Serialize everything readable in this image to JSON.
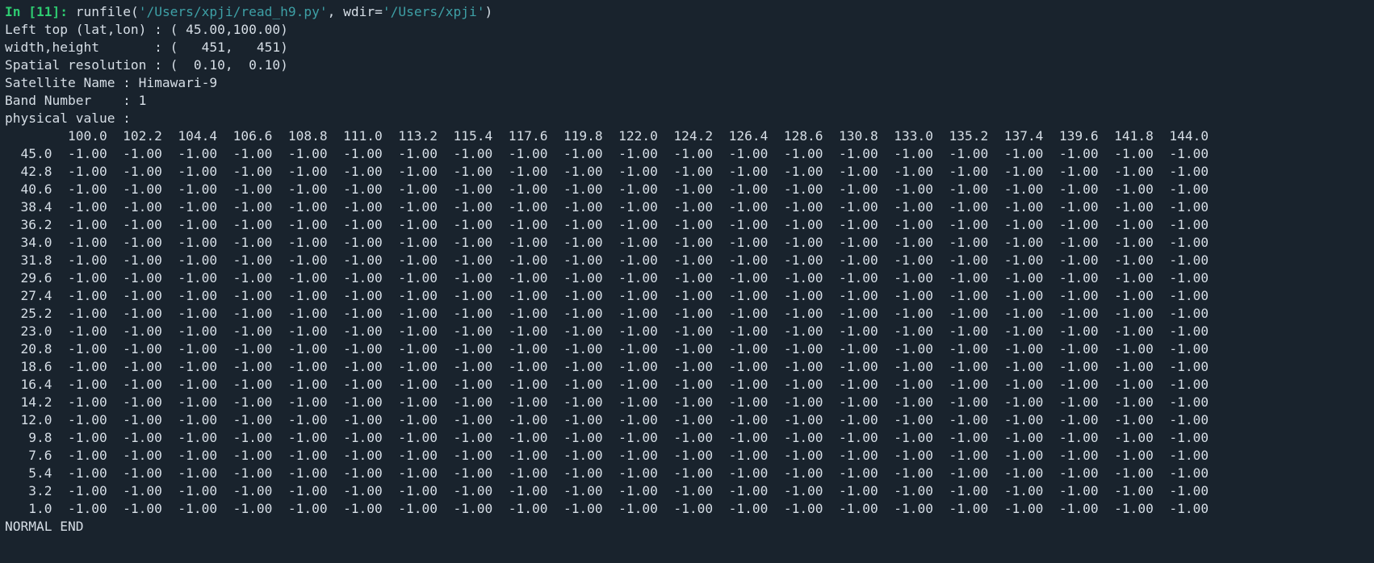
{
  "prompt": {
    "in_label": "In [",
    "exec_num": "11",
    "close": "]: ",
    "func": "runfile(",
    "arg1": "'/Users/xpji/read_h9.py'",
    "comma": ", wdir=",
    "arg2": "'/Users/xpji'",
    "end": ")"
  },
  "header": {
    "lefttop": "Left top (lat,lon) : ( 45.00,100.00)",
    "wh": "width,height       : (   451,   451)",
    "spatial": "Spatial resolution : (  0.10,  0.10)",
    "satname": "Satellite Name : Himawari-9",
    "band": "Band Number    : 1",
    "physval": "physical value :"
  },
  "table": {
    "col_headers": [
      "100.0",
      "102.2",
      "104.4",
      "106.6",
      "108.8",
      "111.0",
      "113.2",
      "115.4",
      "117.6",
      "119.8",
      "122.0",
      "124.2",
      "126.4",
      "128.6",
      "130.8",
      "133.0",
      "135.2",
      "137.4",
      "139.6",
      "141.8",
      "144.0"
    ],
    "row_headers": [
      "45.0",
      "42.8",
      "40.6",
      "38.4",
      "36.2",
      "34.0",
      "31.8",
      "29.6",
      "27.4",
      "25.2",
      "23.0",
      "20.8",
      "18.6",
      "16.4",
      "14.2",
      "12.0",
      "9.8",
      "7.6",
      "5.4",
      "3.2",
      "1.0"
    ],
    "cell_value": "-1.00"
  },
  "footer": "NORMAL END"
}
